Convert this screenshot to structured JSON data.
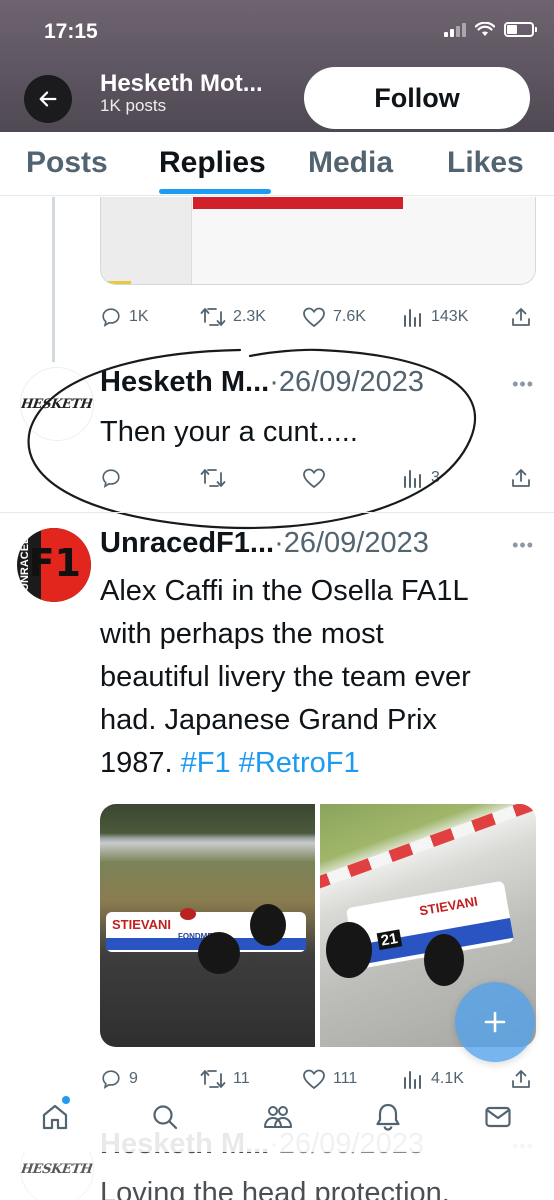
{
  "status_bar": {
    "time": "17:15"
  },
  "header": {
    "profile_name": "Hesketh Mot...",
    "post_count": "1K posts",
    "follow_label": "Follow"
  },
  "tabs": [
    {
      "label": "Posts",
      "active": false
    },
    {
      "label": "Replies",
      "active": true
    },
    {
      "label": "Media",
      "active": false
    },
    {
      "label": "Likes",
      "active": false
    }
  ],
  "accent_color": "#1d9bf0",
  "tweets": [
    {
      "stats": {
        "replies": "1K",
        "retweets": "2.3K",
        "likes": "7.6K",
        "views": "143K"
      }
    },
    {
      "author": "Hesketh M...",
      "date": "·26/09/2023",
      "avatar_label": "HESKETH",
      "text": "Then your a cunt.....",
      "stats": {
        "replies": "",
        "retweets": "",
        "likes": "",
        "views": "3"
      }
    },
    {
      "author": "UnracedF1...",
      "date": "·26/09/2023",
      "avatar_label": "F1",
      "avatar_side_label": "UNRACED",
      "text_lines": [
        "Alex Caffi in the Osella FA1L",
        "with perhaps the most",
        "beautiful livery the team ever",
        "had. Japanese Grand Prix"
      ],
      "last_line_text": "1987. ",
      "hashtags": [
        "#F1",
        "#RetroF1"
      ],
      "photo_sponsor": "STIEVANI",
      "photo_sponsor_2": "FONDMETAL",
      "car_number": "21",
      "stats": {
        "replies": "9",
        "retweets": "11",
        "likes": "111",
        "views": "4.1K"
      }
    },
    {
      "author": "Hesketh M...",
      "date": "·26/09/2023",
      "avatar_label": "HESKETH",
      "text": "Loving the head protection."
    }
  ],
  "bottom_nav": [
    "home-icon",
    "search-icon",
    "communities-icon",
    "notifications-icon",
    "messages-icon"
  ]
}
